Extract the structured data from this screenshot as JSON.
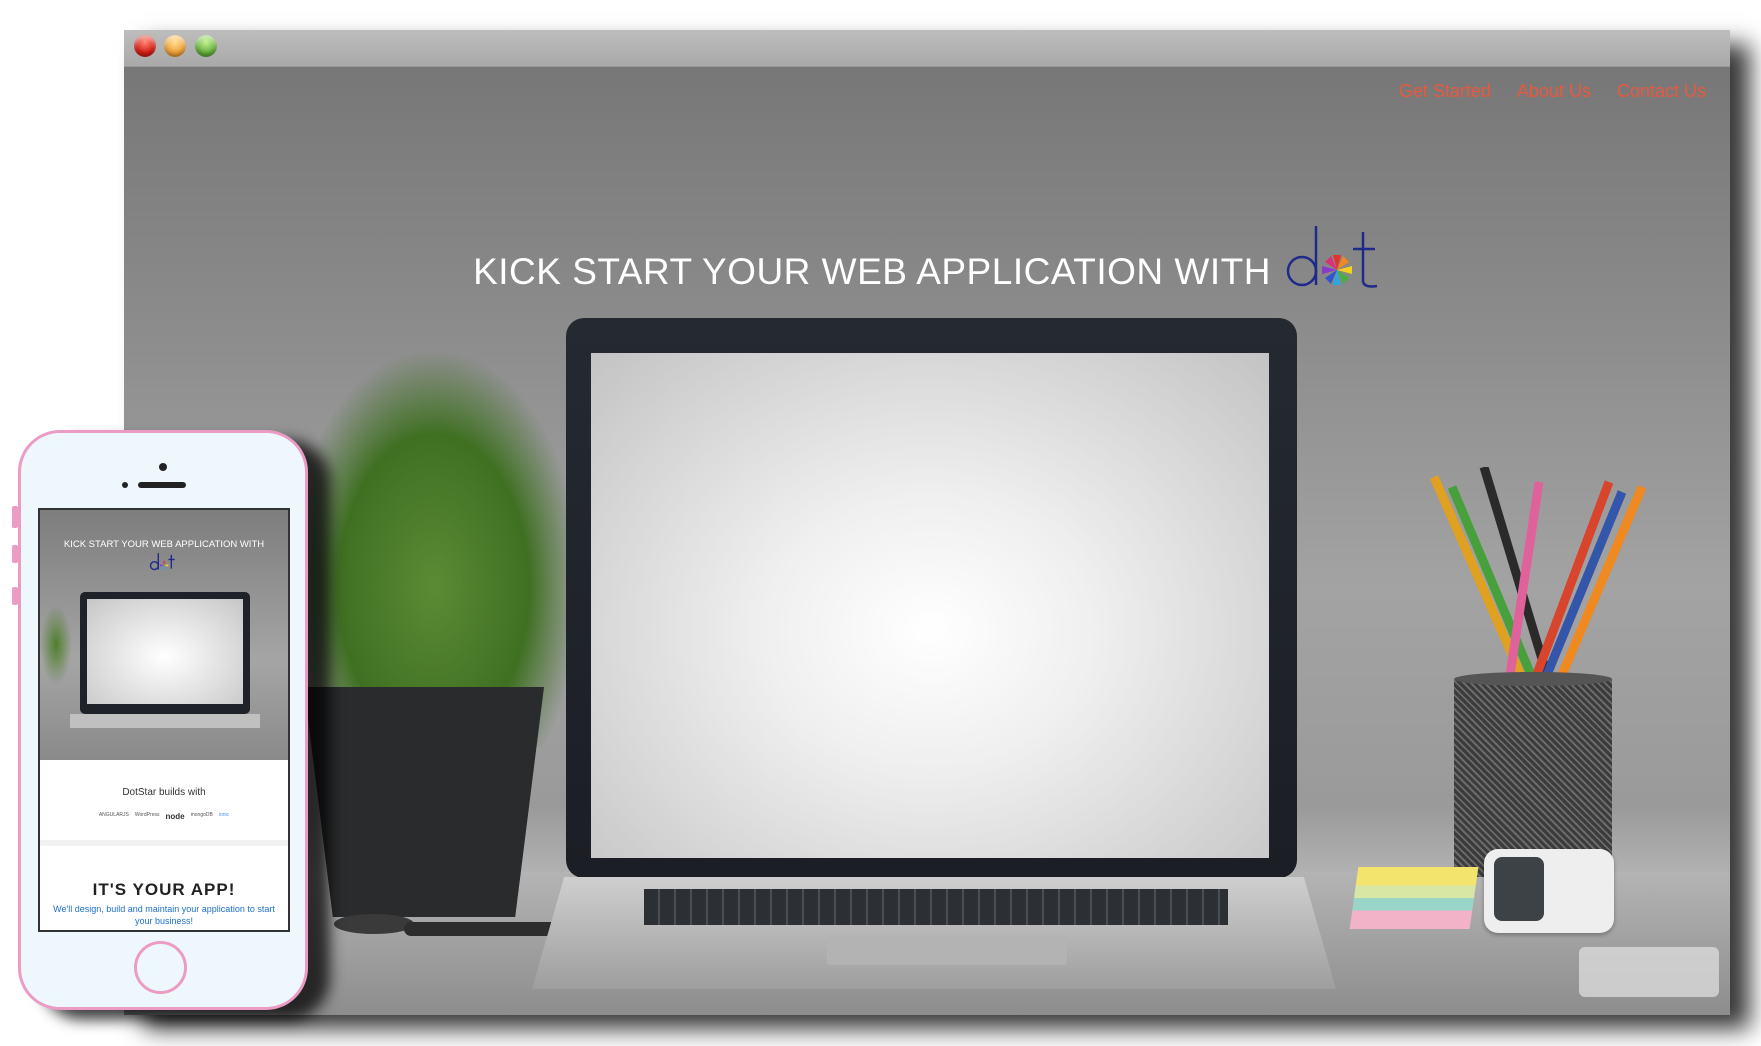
{
  "desktop": {
    "nav": [
      "Get Started",
      "About Us",
      "Contact Us"
    ],
    "headline": "KICK START YOUR WEB APPLICATION WITH",
    "logo_text": "dot"
  },
  "mobile": {
    "headline": "KICK START YOUR WEB APPLICATION WITH",
    "logo_text": "dot",
    "builds_with": "DotStar builds with",
    "tech_logos": [
      "ANGULARJS",
      "WordPress",
      "node",
      "mongoDB",
      "ionic"
    ],
    "app_heading": "IT'S YOUR APP!",
    "app_subtext": "We'll design, build and maintain your application to start your business!"
  },
  "colors": {
    "nav_link": "#e8593e",
    "phone_frame": "#ec9cc4",
    "mobile_subtext": "#1e6fc9"
  }
}
